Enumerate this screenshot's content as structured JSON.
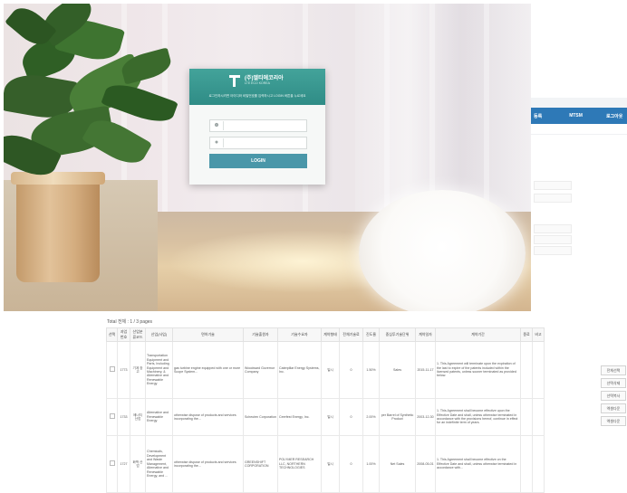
{
  "background_window": {
    "nav": [
      "등록",
      "MTSM",
      "로그아웃"
    ],
    "bar_color": "#2e79b7"
  },
  "login": {
    "logo_name": "(주)엘티에코리아",
    "logo_sub": "LTE ECO KOREA",
    "notice": "로그인하시려면 아이디와 비밀번호를 입력하시고 LOGIN 버튼을 누르세요",
    "id_icon": "user-icon",
    "pw_icon": "lock-icon",
    "id_value": "",
    "pw_value": "",
    "button": "LOGIN",
    "header_color": "#3a9b93",
    "button_color": "#4a97a9"
  },
  "table": {
    "total": "Total 전체 : 1 / 3 pages",
    "headers": [
      "선택",
      "과업번호",
      "산업분류코드",
      "산업(사업)",
      "면허기술",
      "기술출원자",
      "기술수요자",
      "계약형태",
      "전체기술료",
      "진도율",
      "중심투기술단위",
      "계약일자",
      "계약기간",
      "종료",
      "비고"
    ],
    "rows": [
      {
        "no": "1773",
        "code": "기계 장고",
        "industry": "Transportation Equipment and Parts, Including Equipment and Machinery, & Alternative and Renewable Energy",
        "tech": "gas turbine engine equipped with one or more Scope System...",
        "owner": "Woodward Governor Company",
        "buyer": "Caterpillar Energy Systems, Inc.",
        "contract": "일시",
        "fee": "0",
        "rate": "1.50%",
        "unit": "Sales",
        "date": "2015-11-17",
        "period": "1. This Agreement will terminate upon the expiration of the last to expire of the patents included within the licensed patents, unless sooner terminated as provided below."
      },
      {
        "no": "1733",
        "code": "에너지 산업",
        "industry": "Alternative and Renewable Energy",
        "tech": "otherwise dispose of products and services incorporating the...",
        "owner": "Scheuten Corporation",
        "buyer": "Ceerfest Energy, Inc.",
        "contract": "일시",
        "fee": "0",
        "rate": "2.00%",
        "unit": "per Barrel of Synthetic Product",
        "date": "2003-12-30",
        "period": "1. This Agreement shall become effective upon the Effective Date and shall, unless otherwise terminated in accordance with the provisions hereof, continue in effect for an indefinite term of years."
      },
      {
        "no": "1727",
        "code": "화학 산업",
        "industry": "Chemicals, Development and Waste Management, Alternative and Renewable Energy, and ...",
        "tech": "otherwise dispose of products and services incorporating the...",
        "owner": "GREENSHIFT CORPORATION",
        "buyer": "POLYMER RESEARCH LLC, NORTHERN TECHNOLOGIES",
        "contract": "일시",
        "fee": "0",
        "rate": "1.00%",
        "unit": "Net Sales",
        "date": "2008-05-01",
        "period": "1. This Agreement shall become effective on the Effective Date and shall, unless otherwise terminated in accordance with..."
      }
    ]
  },
  "side_buttons": [
    "전체선택",
    "선택삭제",
    "선택복사",
    "엑셀다운",
    "엑셀다운"
  ]
}
